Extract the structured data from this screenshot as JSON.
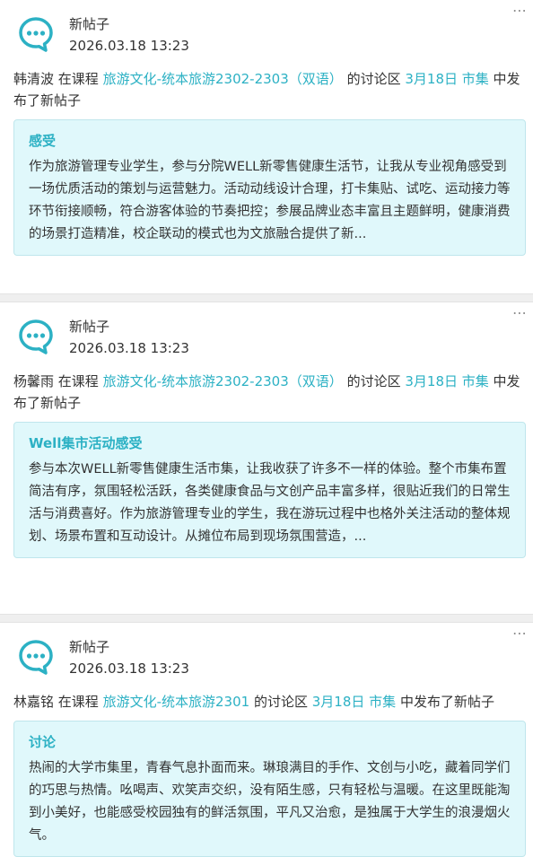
{
  "posts": [
    {
      "type_label": "新帖子",
      "time": "2026.03.18 13:23",
      "author": "韩清波",
      "in_course": "在课程",
      "course": "旅游文化-统本旅游2302-2303（双语）",
      "discussion_area": "的讨论区",
      "topic": "3月18日 市集",
      "posted": "中发布了新帖子",
      "title": "感受",
      "excerpt": "作为旅游管理专业学生，参与分院WELL新零售健康生活节，让我从专业视角感受到一场优质活动的策划与运营魅力。活动动线设计合理，打卡集贴、试吃、运动接力等环节衔接顺畅，符合游客体验的节奏把控；参展品牌业态丰富且主题鲜明，健康消费的场景打造精准，校企联动的模式也为文旅融合提供了新..."
    },
    {
      "type_label": "新帖子",
      "time": "2026.03.18 13:23",
      "author": "杨馨雨",
      "in_course": "在课程",
      "course": "旅游文化-统本旅游2302-2303（双语）",
      "discussion_area": "的讨论区",
      "topic": "3月18日 市集",
      "posted": "中发布了新帖子",
      "title": "Well集市活动感受",
      "excerpt": "参与本次WELL新零售健康生活市集，让我收获了许多不一样的体验。整个市集布置简洁有序，氛围轻松活跃，各类健康食品与文创产品丰富多样，很贴近我们的日常生活与消费喜好。作为旅游管理专业的学生，我在游玩过程中也格外关注活动的整体规划、场景布置和互动设计。从摊位布局到现场氛围营造，..."
    },
    {
      "type_label": "新帖子",
      "time": "2026.03.18 13:23",
      "author": "林嘉铭",
      "in_course": "在课程",
      "course": "旅游文化-统本旅游2301",
      "discussion_area": "的讨论区",
      "topic": "3月18日 市集",
      "posted": "中发布了新帖子",
      "title": "讨论",
      "excerpt": "热闹的大学市集里，青春气息扑面而来。琳琅满目的手作、文创与小吃，藏着同学们的巧思与热情。吆喝声、欢笑声交织，没有陌生感，只有轻松与温暖。在这里既能淘到小美好，也能感受校园独有的鲜活氛围，平凡又治愈，是独属于大学生的浪漫烟火气。"
    }
  ],
  "more_icon": "⋯",
  "colors": {
    "accent": "#2cb1c4",
    "box_bg": "#e0f8fb"
  }
}
